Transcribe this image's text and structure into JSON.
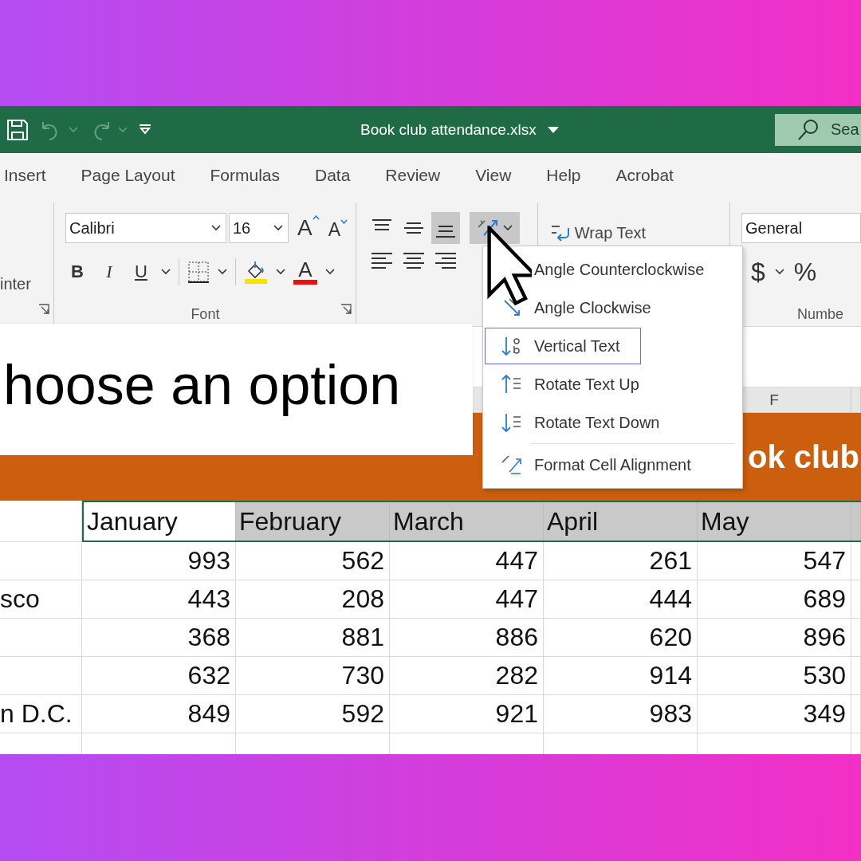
{
  "title_bar": {
    "title": "Book club attendance.xlsx",
    "search_placeholder": "Sea",
    "undo_disabled": true,
    "redo_disabled": true
  },
  "tabs": [
    {
      "label": "Insert"
    },
    {
      "label": "Page Layout"
    },
    {
      "label": "Formulas"
    },
    {
      "label": "Data"
    },
    {
      "label": "Review"
    },
    {
      "label": "View"
    },
    {
      "label": "Help"
    },
    {
      "label": "Acrobat"
    }
  ],
  "ribbon": {
    "clipboard": {
      "format_painter": "inter"
    },
    "font": {
      "font_name": "Calibri",
      "font_size": "16",
      "grow_font": "A",
      "shrink_font": "A",
      "bold": "B",
      "italic": "I",
      "underline": "U",
      "font_color": "A",
      "group_label": "Font"
    },
    "alignment": {
      "vertical_align": [
        {
          "selected": false
        },
        {
          "selected": false
        },
        {
          "selected": true
        }
      ],
      "horizontal_align": [
        {
          "selected": false
        },
        {
          "selected": false
        },
        {
          "selected": false
        }
      ],
      "orientation_selected": true,
      "wrap_text": "Wrap Text"
    },
    "number": {
      "format": "General",
      "currency": "$",
      "percent": "%",
      "group_label": "Numbe"
    }
  },
  "caption": {
    "text": "hoose an option"
  },
  "sheet": {
    "column_letter": "F",
    "banner": "ok club",
    "columns": [
      {
        "label": "January",
        "active": true
      },
      {
        "label": "February",
        "active": false
      },
      {
        "label": "March",
        "active": false
      },
      {
        "label": "April",
        "active": false
      },
      {
        "label": "May",
        "active": false
      }
    ],
    "rows": [
      {
        "values": [
          "993",
          "562",
          "447",
          "261",
          "547"
        ]
      },
      {
        "label": "sco",
        "values": [
          "443",
          "208",
          "447",
          "444",
          "689"
        ]
      },
      {
        "values": [
          "368",
          "881",
          "886",
          "620",
          "896"
        ]
      },
      {
        "values": [
          "632",
          "730",
          "282",
          "914",
          "530"
        ]
      },
      {
        "label": "n D.C.",
        "values": [
          "849",
          "592",
          "921",
          "983",
          "349"
        ]
      }
    ]
  },
  "menu": {
    "items": [
      {
        "label": "Angle Counterclockwise",
        "kind": "angle_ccw",
        "selected": false
      },
      {
        "label": "Angle Clockwise",
        "kind": "angle_cw",
        "selected": false
      },
      {
        "label": "Vertical Text",
        "kind": "vertical",
        "selected": true
      },
      {
        "label": "Rotate Text Up",
        "kind": "rotate_up",
        "selected": false
      },
      {
        "label": "Rotate Text Down",
        "kind": "rotate_down",
        "selected": false
      },
      {
        "kind": "separator"
      },
      {
        "label": "Format Cell Alignment",
        "kind": "format",
        "selected": false
      }
    ]
  }
}
